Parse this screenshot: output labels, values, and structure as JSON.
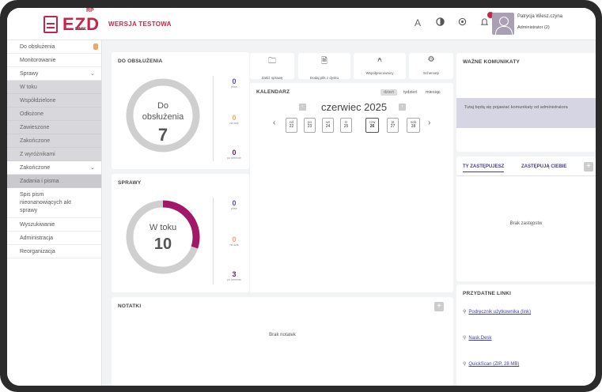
{
  "app": {
    "logo_text": "EZD",
    "logo_sup": "RP",
    "logo_sub": "NASK",
    "version_label": "WERSJA TESTOWA"
  },
  "topbar": {
    "font_size_label": "A",
    "user_name": "Patrycja Wiesz.czyna",
    "user_role": "Administrator (2)",
    "accent_color": "#c6254a",
    "icons": [
      "font-size-icon",
      "contrast-icon",
      "settings-icon",
      "notification-icon"
    ]
  },
  "sidebar": {
    "items": [
      {
        "label": "Do obsłużenia"
      },
      {
        "label": "Monitorowanie"
      },
      {
        "label": "Sprawy",
        "chevron": "⌄"
      },
      {
        "label": "W toku"
      },
      {
        "label": "Współdzielone"
      },
      {
        "label": "Odłożone"
      },
      {
        "label": "Zawieszone"
      },
      {
        "label": "Zakończone"
      },
      {
        "label": "Z wyróżnikami"
      },
      {
        "label": "Zakończone",
        "chevron": "⌄"
      },
      {
        "label": "Zadania i pisma"
      },
      {
        "label": "Spis pism nieonanowiących akt sprawy"
      },
      {
        "label": "Wyszukiwanie"
      },
      {
        "label": "Administracja"
      },
      {
        "label": "Reorganizacja"
      }
    ]
  },
  "do_obsluzenia": {
    "title": "DO OBSŁUŻENIA",
    "ring_line1": "Do",
    "ring_line2": "obsłużenia",
    "ring_value": "7",
    "ring_fraction": 0,
    "stats": [
      {
        "value": "0",
        "label": "pilne",
        "color": "#5a4a9a"
      },
      {
        "value": "0",
        "label": "na dziś",
        "color": "#f1a56b"
      },
      {
        "value": "0",
        "label": "po terminie",
        "color": "#6a1b4d"
      }
    ]
  },
  "sprawy": {
    "title": "SPRAWY",
    "ring_line1": "W toku",
    "ring_value": "10",
    "ring_fraction": 0.3,
    "ring_color": "#a3176b",
    "stats": [
      {
        "value": "0",
        "label": "pilne",
        "color": "#5a4a9a"
      },
      {
        "value": "0",
        "label": "na dziś",
        "color": "#f1a56b"
      },
      {
        "value": "3",
        "label": "po terminie",
        "color": "#6a1b4d"
      }
    ]
  },
  "quick_actions": [
    {
      "label": "Załóż sprawę",
      "icon": "folder-icon",
      "glyph": "🗀"
    },
    {
      "label": "Dodaj plik z dysku",
      "icon": "file-icon",
      "glyph": "🗎"
    },
    {
      "label": "Współpracownicy",
      "icon": "people-icon",
      "glyph": "⍲"
    },
    {
      "label": "Schematy",
      "icon": "schema-icon",
      "glyph": "⚙"
    }
  ],
  "calendar": {
    "title": "KALENDARZ",
    "view_day": "dzień",
    "view_week": "tydzień",
    "view_month": "miesiąc",
    "month_label": "czerwiec 2025",
    "prev": "‹",
    "next": "›",
    "days": [
      {
        "name": "nd",
        "num": "22"
      },
      {
        "name": "pn",
        "num": "23"
      },
      {
        "name": "wt",
        "num": "24"
      },
      {
        "name": "śr",
        "num": "25"
      },
      {
        "name": "czw",
        "num": "26",
        "today": true
      },
      {
        "name": "pt",
        "num": "27"
      },
      {
        "name": "sob",
        "num": "28"
      }
    ]
  },
  "komunikaty": {
    "title": "WAŻNE KOMUNIKATY",
    "message": "Tutaj będą się pojawiać komunikaty od administratora"
  },
  "zastepstwa": {
    "tab1": "TY ZASTĘPUJESZ",
    "tab2": "ZASTĘPUJĄ CIEBIE",
    "add": "+",
    "empty": "Brak zastępstw"
  },
  "notatki": {
    "title": "NOTATKI",
    "add": "+",
    "empty": "Brak notatek"
  },
  "linki": {
    "title": "PRZYDATNE LINKI",
    "items": [
      {
        "label": "Podręcznik użytkownika (link)"
      },
      {
        "label": "Nask.Desk"
      },
      {
        "label": "QuickScan (ZIP, 28 MB)"
      }
    ]
  }
}
